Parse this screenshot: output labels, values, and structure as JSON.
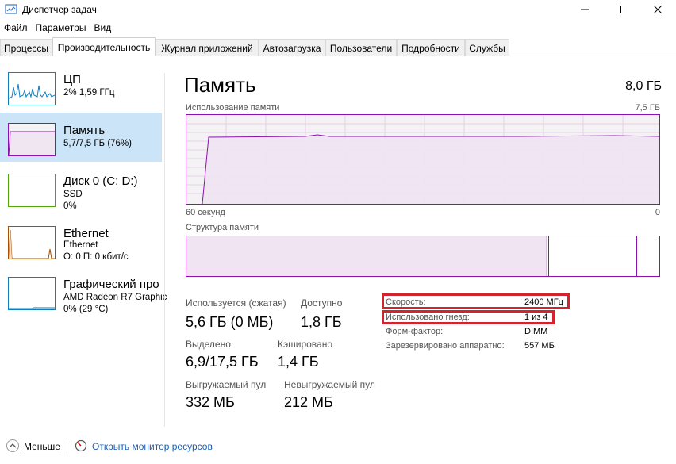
{
  "window": {
    "title": "Диспетчер задач",
    "controls": {
      "minimize": "minimize-icon",
      "maximize": "maximize-icon",
      "close": "close-icon"
    }
  },
  "menu": [
    "Файл",
    "Параметры",
    "Вид"
  ],
  "tabs": [
    "Процессы",
    "Производительность",
    "Журнал приложений",
    "Автозагрузка",
    "Пользователи",
    "Подробности",
    "Службы"
  ],
  "active_tab": "Производительность",
  "sidebar": {
    "items": [
      {
        "name": "ЦП",
        "line1": "2% 1,59 ГГц",
        "line2": "",
        "color": "#117dbb"
      },
      {
        "name": "Память",
        "line1": "5,7/7,5 ГБ (76%)",
        "line2": "",
        "color": "#8b12ae",
        "selected": true
      },
      {
        "name": "Диск 0 (C: D:)",
        "line1": "SSD",
        "line2": "0%",
        "color": "#4da60c"
      },
      {
        "name": "Ethernet",
        "line1": "Ethernet",
        "line2": "О: 0 П: 0 кбит/с",
        "color": "#a74f01"
      },
      {
        "name": "Графический про",
        "line1": "AMD Radeon R7 Graphic",
        "line2": "0% (29 °C)",
        "color": "#117dbb"
      }
    ]
  },
  "main": {
    "title": "Память",
    "total": "8,0 ГБ",
    "usage_graph": {
      "label": "Использование памяти",
      "max": "7,5 ГБ",
      "x_left": "60 секунд",
      "x_right": "0",
      "usage_fraction_after_rise": 0.76
    },
    "composition_graph": {
      "label": "Структура памяти",
      "in_use_fraction": 0.76,
      "free_start_fraction": 0.76,
      "standby_end_fraction": 0.95
    },
    "stats": {
      "in_use_label": "Используется (сжатая)",
      "in_use_value": "5,6 ГБ (0 МБ)",
      "available_label": "Доступно",
      "available_value": "1,8 ГБ",
      "committed_label": "Выделено",
      "committed_value": "6,9/17,5 ГБ",
      "cached_label": "Кэшировано",
      "cached_value": "1,4 ГБ",
      "paged_label": "Выгружаемый пул",
      "paged_value": "332 МБ",
      "nonpaged_label": "Невыгружаемый пул",
      "nonpaged_value": "212 МБ"
    },
    "properties": {
      "speed_label": "Скорость:",
      "speed_value": "2400 МГц",
      "slots_label": "Использовано гнезд:",
      "slots_value": "1 из 4",
      "form_label": "Форм-фактор:",
      "form_value": "DIMM",
      "reserved_label": "Зарезервировано аппаратно:",
      "reserved_value": "557 МБ"
    }
  },
  "footer": {
    "less": "Меньше",
    "resource_monitor": "Открыть монитор ресурсов"
  },
  "colors": {
    "memory": "#8b12ae",
    "highlight": "#d3232f",
    "selected_bg": "#cce4f7",
    "link": "#1a5fb4"
  }
}
